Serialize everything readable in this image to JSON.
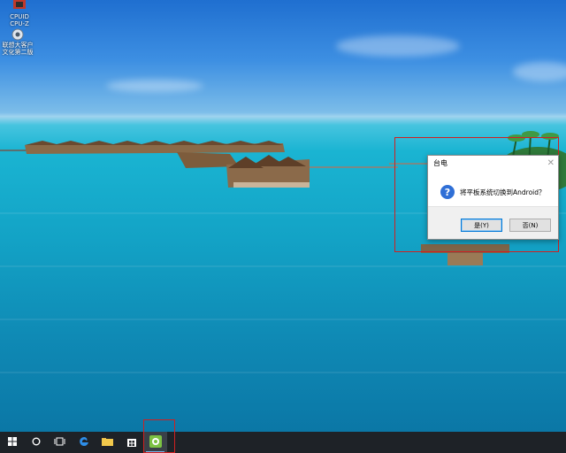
{
  "desktop": {
    "icons": [
      {
        "label_line1": "CPUID",
        "label_line2": "CPU-Z",
        "icon": "cpuz-icon"
      },
      {
        "label_line1": "联想大客户",
        "label_line2": "文化第二版",
        "icon": "lenovo-app-icon"
      }
    ],
    "wallpaper": "maldives-water-villas"
  },
  "dialog": {
    "title": "台电",
    "close_symbol": "✕",
    "question_symbol": "?",
    "message": "将平板系统切换到Android？",
    "yes_label": "是(Y)",
    "no_label": "否(N)"
  },
  "taskbar": {
    "items": [
      {
        "name": "start-button",
        "icon": "windows-logo-icon"
      },
      {
        "name": "search-button",
        "icon": "cortana-circle-icon"
      },
      {
        "name": "task-view-button",
        "icon": "task-view-icon"
      },
      {
        "name": "edge-button",
        "icon": "edge-icon"
      },
      {
        "name": "file-explorer-button",
        "icon": "folder-icon"
      },
      {
        "name": "store-button",
        "icon": "store-icon"
      },
      {
        "name": "switch-os-app-button",
        "icon": "android-switch-icon"
      }
    ]
  },
  "colors": {
    "highlight_box": "#d02020",
    "accent": "#0078d7",
    "taskbar": "#1e2227"
  }
}
